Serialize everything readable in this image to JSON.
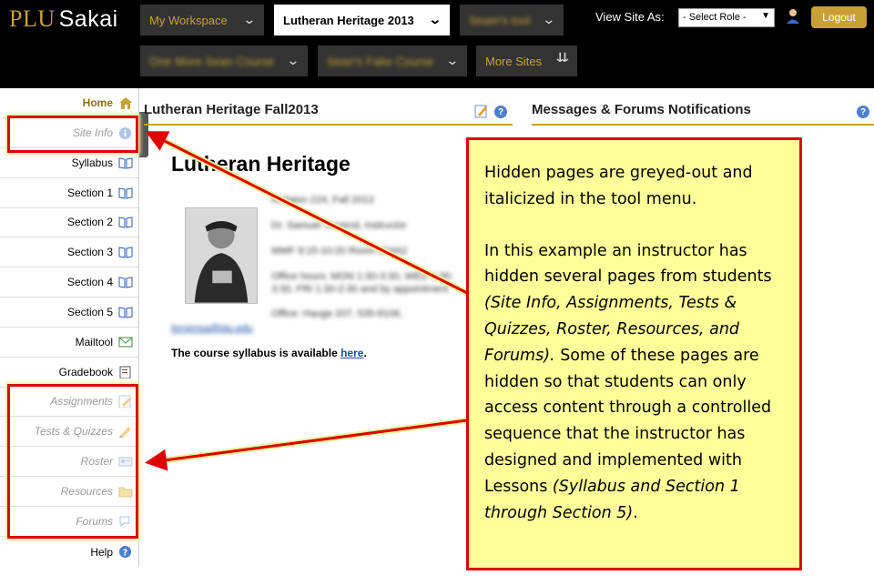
{
  "header": {
    "logo_plu": "PLU",
    "logo_sakai": "Sakai",
    "site_tabs": [
      "My Workspace",
      "Lutheran Heritage 2013",
      "Seam's tool",
      "One More Sean Course",
      "Sean's Fake Course",
      "More Sites"
    ],
    "view_site_as_label": "View Site As:",
    "role_select": "- Select Role -",
    "logout_label": "Logout"
  },
  "tool_menu": [
    {
      "label": "Home",
      "icon": "home-icon",
      "hidden": false
    },
    {
      "label": "Site Info",
      "icon": "info-icon",
      "hidden": true
    },
    {
      "label": "Syllabus",
      "icon": "book-icon",
      "hidden": false
    },
    {
      "label": "Section 1",
      "icon": "book-icon",
      "hidden": false
    },
    {
      "label": "Section 2",
      "icon": "book-icon",
      "hidden": false
    },
    {
      "label": "Section 3",
      "icon": "book-icon",
      "hidden": false
    },
    {
      "label": "Section 4",
      "icon": "book-icon",
      "hidden": false
    },
    {
      "label": "Section 5",
      "icon": "book-icon",
      "hidden": false
    },
    {
      "label": "Mailtool",
      "icon": "mail-icon",
      "hidden": false
    },
    {
      "label": "Gradebook",
      "icon": "gradebook-icon",
      "hidden": false
    },
    {
      "label": "Assignments",
      "icon": "assignment-icon",
      "hidden": true
    },
    {
      "label": "Tests & Quizzes",
      "icon": "pencil-icon",
      "hidden": true
    },
    {
      "label": "Roster",
      "icon": "roster-icon",
      "hidden": true
    },
    {
      "label": "Resources",
      "icon": "folder-icon",
      "hidden": true
    },
    {
      "label": "Forums",
      "icon": "forums-icon",
      "hidden": true
    },
    {
      "label": "Help",
      "icon": "help-icon",
      "hidden": false
    }
  ],
  "main": {
    "site_title": "Lutheran Heritage Fall2013",
    "messages_title": "Messages & Forums Notifications",
    "course_heading": "Lutheran Heritage",
    "info_lines": [
      "Religion 224, Fall 2013",
      "Dr. Samuel Torvend, Instructor",
      "MWF 8:15-10:20 Room 204A2",
      "Office hours: MON 1:30-3:30, WED 1:30-",
      "3:30, FRI 1:30-2:30 and by appointment",
      "Office: Hauge 207, 535-8106,"
    ],
    "email": "torvensa@plu.edu",
    "syllabus_prefix": "The course syllabus is available ",
    "syllabus_link": "here",
    "syllabus_suffix": ".",
    "messages_fragment": "e"
  },
  "callout": {
    "para1": "Hidden pages are greyed-out and italicized in the tool menu.",
    "para2_lead": "In this example an instructor has hidden several pages from students ",
    "para2_italic1": "(Site Info, Assignments, Tests & Quizzes, Roster, Resources, and Forums).",
    "para2_mid": " Some of these pages are hidden so that students can only access content through a controlled sequence that the instructor has designed and implemented with Lessons ",
    "para2_italic2": "(Syllabus and Section 1 through Section 5)",
    "para2_end": "."
  },
  "colors": {
    "accent_gold": "#c8a034",
    "header_bg": "#000000",
    "callout_bg": "#ffff99",
    "callout_border": "#e00000",
    "hidden_text": "#999999"
  }
}
